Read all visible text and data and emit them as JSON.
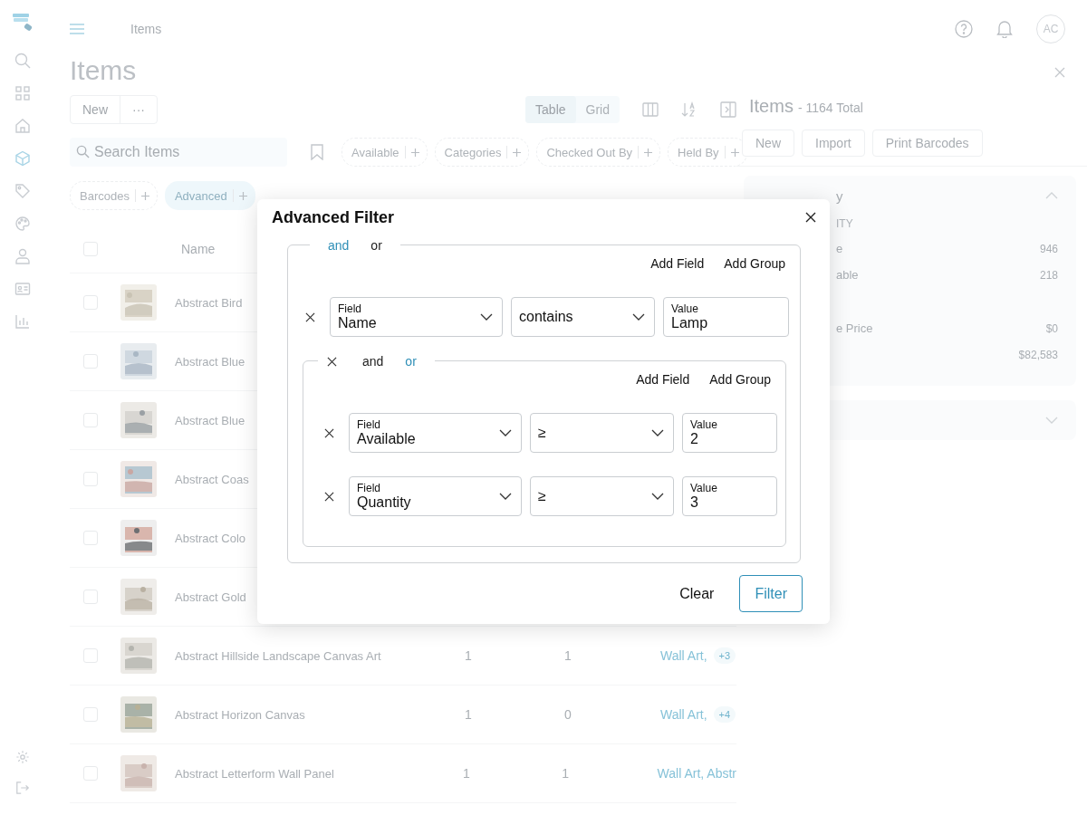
{
  "sidebar": {
    "items": [
      {
        "selected": false
      },
      {
        "selected": false
      },
      {
        "selected": false
      },
      {
        "selected": true
      },
      {
        "selected": false
      },
      {
        "selected": false
      },
      {
        "selected": false
      },
      {
        "selected": false
      },
      {
        "selected": false
      }
    ]
  },
  "topbar": {
    "breadcrumb": "Items",
    "avatar": "AC"
  },
  "page": {
    "title": "Items",
    "actions": [
      "New",
      "···"
    ]
  },
  "view_toggle": [
    {
      "label": "Table",
      "selected": true
    },
    {
      "label": "Grid",
      "selected": false
    }
  ],
  "search": {
    "placeholder": "Search Items"
  },
  "filter_chips": [
    {
      "label": "Available",
      "selected": false
    },
    {
      "label": "Categories",
      "selected": false
    },
    {
      "label": "Checked Out By",
      "selected": false
    },
    {
      "label": "Held By",
      "selected": false
    }
  ],
  "filter_chips_2": [
    {
      "label": "Barcodes",
      "selected": false
    },
    {
      "label": "Advanced",
      "selected": true
    }
  ],
  "table": {
    "columns": [
      "Name"
    ],
    "select_all": {
      "checked": false
    },
    "rows": [
      {
        "checked": false,
        "name": "Abstract Bird"
      },
      {
        "checked": false,
        "name": "Abstract Blue"
      },
      {
        "checked": false,
        "name": "Abstract Blue"
      },
      {
        "checked": false,
        "name": "Abstract Coas"
      },
      {
        "checked": false,
        "name": "Abstract Colo"
      },
      {
        "checked": false,
        "name": "Abstract Gold"
      },
      {
        "checked": false,
        "name": "Abstract Hillside Landscape Canvas Art",
        "column_2": "1",
        "column_3": "1",
        "categories": "Wall Art,",
        "more": "+3"
      },
      {
        "checked": false,
        "name": "Abstract Horizon Canvas",
        "column_2": "1",
        "column_3": "0",
        "categories": "Wall Art,",
        "more": "+4"
      },
      {
        "checked": false,
        "name": "Abstract Letterform Wall Panel",
        "column_2": "1",
        "column_3": "1",
        "categories": "Wall Art, Abstr"
      }
    ]
  },
  "details_panel": {
    "title": "Items",
    "subtitle": "- 1164 Total",
    "actions": [
      "New",
      "Import",
      "Print Barcodes"
    ],
    "summary": {
      "title": "y",
      "expanded": true,
      "sections": [
        {
          "title": "ITY",
          "rows": [
            {
              "label": "e",
              "value": "946"
            },
            {
              "label": "able",
              "value": "218"
            }
          ]
        },
        {
          "rows": [
            {
              "label": "e Price",
              "value": "$0"
            },
            {
              "value": "$82,583"
            }
          ]
        }
      ]
    },
    "second_card": {
      "expanded": false
    }
  },
  "modal": {
    "title": "Advanced Filter",
    "root": {
      "logic": [
        {
          "label": "and",
          "selected": true
        },
        {
          "label": "or",
          "selected": false
        }
      ],
      "actions": [
        "Add Field",
        "Add Group"
      ],
      "children": [
        {
          "kind": "condition",
          "field_label": "Field",
          "field": "Name",
          "operator": "contains",
          "value_label": "Value",
          "value": "Lamp"
        },
        {
          "kind": "group",
          "logic": [
            {
              "label": "and",
              "selected": false
            },
            {
              "label": "or",
              "selected": true
            }
          ],
          "actions": [
            "Add Field",
            "Add Group"
          ],
          "children": [
            {
              "kind": "condition",
              "field_label": "Field",
              "field": "Available",
              "operator": "≥",
              "value_label": "Value",
              "value": "2"
            },
            {
              "kind": "condition",
              "field_label": "Field",
              "field": "Quantity",
              "operator": "≥",
              "value_label": "Value",
              "value": "3"
            }
          ]
        }
      ]
    },
    "buttons": [
      {
        "label": "Clear",
        "kind": "text"
      },
      {
        "label": "Filter",
        "kind": "primary"
      }
    ]
  }
}
